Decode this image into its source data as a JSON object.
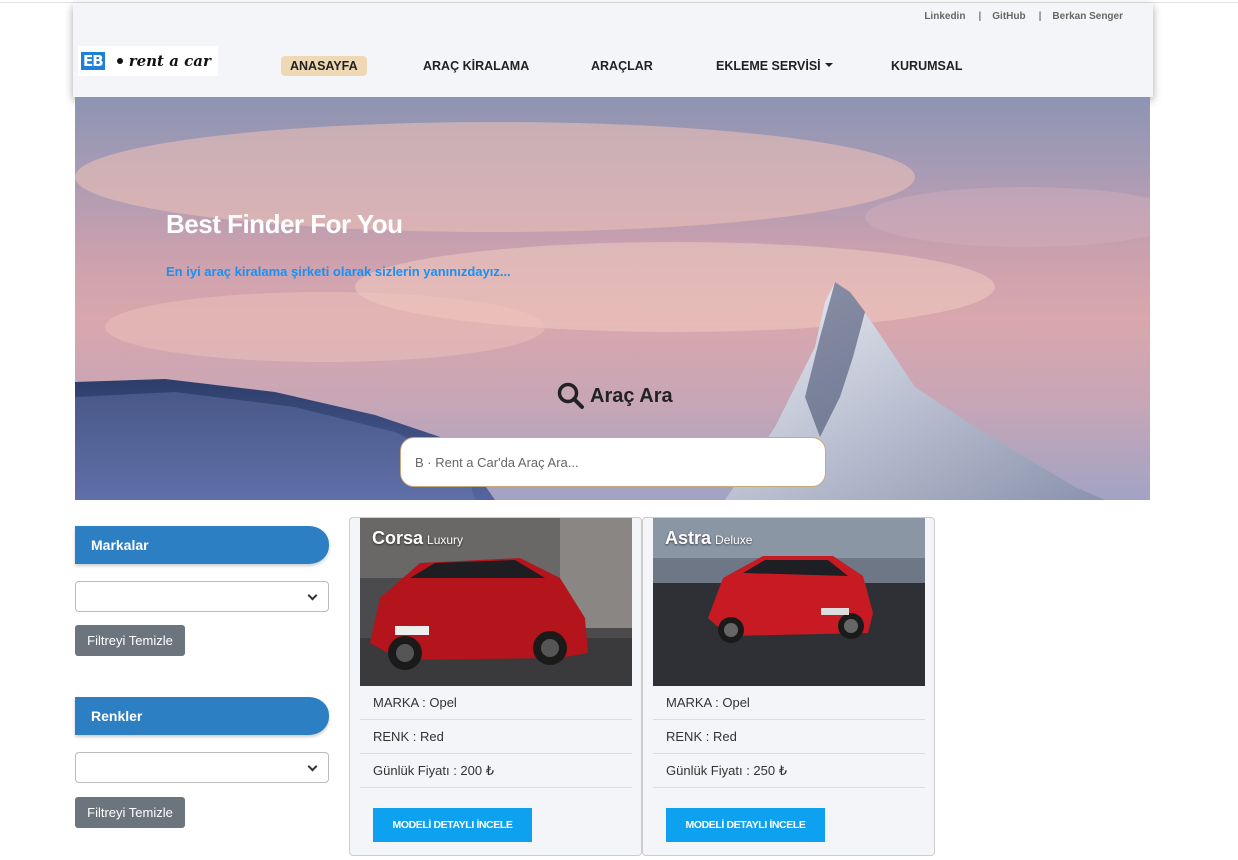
{
  "header": {
    "top_links": [
      "Linkedin",
      "GitHub",
      "Berkan Senger"
    ],
    "logo": {
      "mark": "EB",
      "text": "rent a car"
    },
    "nav": [
      {
        "label": "ANASAYFA",
        "active": true
      },
      {
        "label": "ARAÇ KİRALAMA"
      },
      {
        "label": "ARAÇLAR"
      },
      {
        "label": "EKLEME SERVİSİ",
        "dropdown": true
      },
      {
        "label": "KURUMSAL"
      }
    ]
  },
  "hero": {
    "title": "Best Finder For You",
    "subtitle": "En iyi araç kiralama şirketi olarak sizlerin yanınızdayız...",
    "search_label": "Araç Ara",
    "search_placeholder": "B · Rent a Car'da Araç Ara...",
    "search_icon": "search-icon"
  },
  "sidebar": {
    "brands": {
      "title": "Markalar",
      "selected": "",
      "clear_label": "Filtreyi Temizle"
    },
    "colors": {
      "title": "Renkler",
      "selected": "",
      "clear_label": "Filtreyi Temizle"
    }
  },
  "cars": [
    {
      "model": "Corsa",
      "trim": "Luxury",
      "brand": "MARKA : Opel",
      "color": "RENK : Red",
      "price": "Günlük Fiyatı : 200 ₺",
      "button": "MODELİ DETAYLI İNCELE"
    },
    {
      "model": "Astra",
      "trim": "Deluxe",
      "brand": "MARKA : Opel",
      "color": "RENK : Red",
      "price": "Günlük Fiyatı : 250 ₺",
      "button": "MODELİ DETAYLI İNCELE"
    }
  ],
  "colors": {
    "accent": "#2d7fc4",
    "button": "#0ea1f0",
    "active_nav": "#efd9b4",
    "link": "#1c8ff0"
  }
}
